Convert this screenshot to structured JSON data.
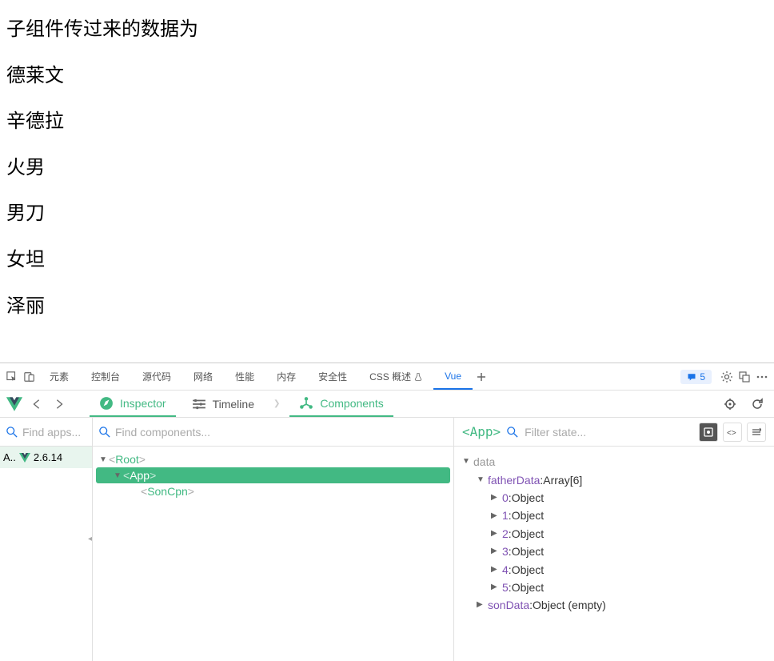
{
  "page": {
    "heading": "子组件传过来的数据为",
    "items": [
      "德莱文",
      "辛德拉",
      "火男",
      "男刀",
      "女坦",
      "泽丽"
    ]
  },
  "devtools": {
    "tabs": [
      "元素",
      "控制台",
      "源代码",
      "网络",
      "性能",
      "内存",
      "安全性",
      "CSS 概述",
      "Vue"
    ],
    "active_tab": "Vue",
    "issues_count": "5"
  },
  "vue_header": {
    "tabs": {
      "inspector": "Inspector",
      "timeline": "Timeline",
      "components": "Components"
    }
  },
  "apps": {
    "search_placeholder": "Find apps...",
    "app_label": "A..",
    "version": "2.6.14"
  },
  "components": {
    "search_placeholder": "Find components...",
    "tree": {
      "root": "Root",
      "app": "App",
      "son": "SonCpn"
    }
  },
  "state": {
    "component_name": "<App>",
    "filter_placeholder": "Filter state...",
    "section": "data",
    "fatherData": {
      "key": "fatherData",
      "type": "Array[6]",
      "items": [
        {
          "idx": "0",
          "val": "Object"
        },
        {
          "idx": "1",
          "val": "Object"
        },
        {
          "idx": "2",
          "val": "Object"
        },
        {
          "idx": "3",
          "val": "Object"
        },
        {
          "idx": "4",
          "val": "Object"
        },
        {
          "idx": "5",
          "val": "Object"
        }
      ]
    },
    "sonData": {
      "key": "sonData",
      "type": "Object (empty)"
    }
  }
}
